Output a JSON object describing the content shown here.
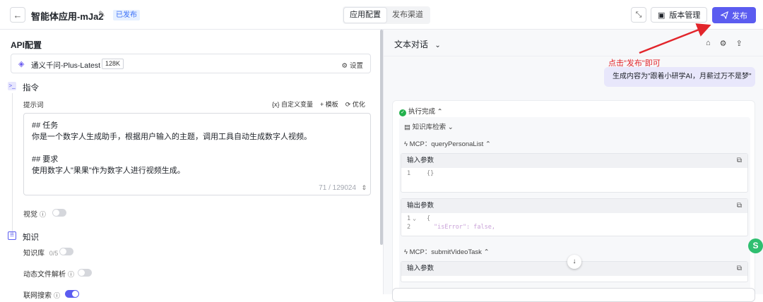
{
  "header": {
    "back_icon": "arrow-left-icon",
    "title": "智能体应用-mJa2",
    "status_badge": "已发布",
    "tabs": [
      {
        "label": "应用配置",
        "active": true
      },
      {
        "label": "发布渠道",
        "active": false
      }
    ],
    "version_label": "版本管理",
    "publish_label": "发布",
    "accent_color": "#5b5cf0"
  },
  "left": {
    "section_title": "API配置",
    "model": {
      "name": "通义千问-Plus-Latest",
      "tag": "128K",
      "settings_label": "设置"
    },
    "instructions": {
      "title": "指令",
      "prompt_label": "提示词",
      "actions": [
        "{x} 自定义变量",
        "+ 模板",
        "⟳ 优化"
      ],
      "prompt_lines": [
        "## 任务",
        "你是一个数字人生成助手，根据用户输入的主题，调用工具自动生成数字人视频。",
        "",
        "## 要求",
        "使用数字人\"果果\"作为数字人进行视频生成。"
      ],
      "counter": "71 / 129024"
    },
    "vision_label": "视觉",
    "knowledge": {
      "title": "知识",
      "kb_label": "知识库",
      "kb_count": "0/5",
      "dynamic_label": "动态文件解析",
      "partial_label": "联网搜索"
    }
  },
  "right": {
    "chat_mode": "文本对话",
    "annotation": "点击\"发布\"即可",
    "user_message": "生成内容为\"跟着小研学AI，月薪过万不是梦\"",
    "exec_status": "执行完成",
    "kb_search": "知识库检索",
    "mcp_step_1": "MCP：queryPersonaList",
    "mcp_step_2": "MCP：submitVideoTask",
    "input_params": "输入参数",
    "output_params": "输出参数",
    "code_in": {
      "num": "1",
      "text": "{}"
    },
    "code_out": [
      {
        "num": "1",
        "text": "{"
      },
      {
        "num": "2",
        "text": "\"isError\": false,"
      }
    ],
    "annotation_color": "#e2252b"
  }
}
